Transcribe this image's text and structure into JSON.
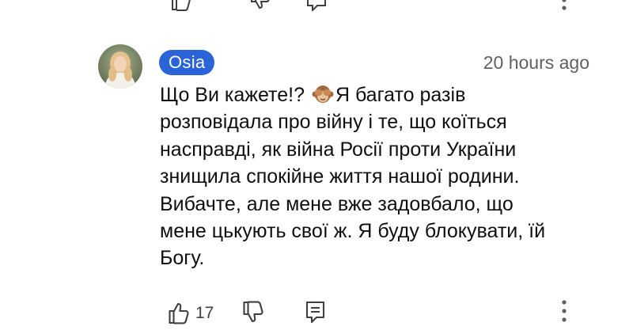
{
  "comment": {
    "author": "Osia",
    "timestamp": "20 hours ago",
    "text_line1_before_emoji": "Що Ви кажете!?",
    "emoji": "see-no-evil-monkey",
    "text_line1_after_emoji": "Я багато разів",
    "text_rest": "розповідала про війну і те, що коїться\nнасправді, як війна Росії проти України\nзнищила спокійне життя нашої родини.\nВибачте, але мене вже задовбало, що\nмене цькують свої ж. Я буду блокувати, їй\nБогу.",
    "like_count": "17"
  },
  "icons": {
    "like": "thumbs-up-icon",
    "dislike": "thumbs-down-icon",
    "reply": "reply-comment-icon",
    "more": "more-vertical-icon"
  },
  "colors": {
    "author_chip_bg": "#2b63d9",
    "timestamp": "#606060",
    "text": "#0f0f0f",
    "icon": "#3f3f3f"
  }
}
